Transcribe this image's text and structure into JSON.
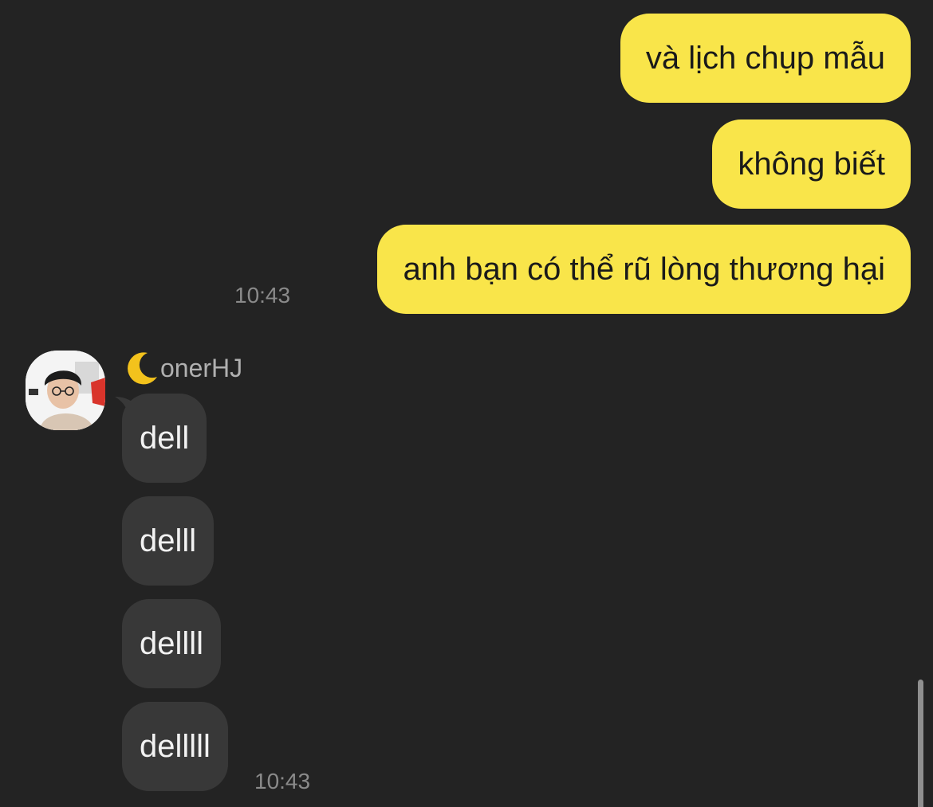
{
  "colors": {
    "background": "#232323",
    "outgoing_bubble": "#f9e54a",
    "incoming_bubble": "#383838",
    "timestamp": "#8a8a8a"
  },
  "outgoing": {
    "messages": [
      "và lịch chụp mẫu",
      "không biết",
      "anh bạn có thể rũ lòng thương hại"
    ],
    "timestamp": "10:43"
  },
  "incoming": {
    "sender_emoji_icon": "crescent-moon-icon",
    "sender_name": "onerHJ",
    "avatar": "user-avatar-photo",
    "messages": [
      "dell",
      "delll",
      "dellll",
      "delllll"
    ],
    "timestamp": "10:43"
  }
}
